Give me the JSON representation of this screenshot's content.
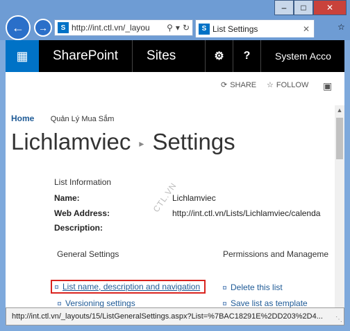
{
  "browser": {
    "window_controls": {
      "minimize": "–",
      "maximize": "□",
      "close": "✕"
    },
    "address": "http://int.ctl.vn/_layou",
    "tab_title": "List Settings",
    "status_url": "http://int.ctl.vn/_layouts/15/ListGeneralSettings.aspx?List=%7BAC18291E%2DD203%2D4..."
  },
  "suitebar": {
    "brand": "SharePoint",
    "sites": "Sites",
    "user": "System Acco"
  },
  "actions": {
    "share": "SHARE",
    "follow": "FOLLOW"
  },
  "breadcrumb": {
    "home": "Home",
    "site": "Quản Lý Mua Sắm"
  },
  "title": {
    "site": "Lichlamviec",
    "page": "Settings"
  },
  "watermark": "CTL.VN",
  "list_info": {
    "heading": "List Information",
    "name_label": "Name:",
    "name_value": "Lichlamviec",
    "web_label": "Web Address:",
    "web_value": "http://int.ctl.vn/Lists/Lichlamviec/calenda",
    "desc_label": "Description:"
  },
  "general": {
    "heading": "General Settings",
    "links": [
      "List name, description and navigation",
      "Versioning settings"
    ]
  },
  "permissions": {
    "heading": "Permissions and Manageme",
    "links": [
      "Delete this list",
      "Save list as template"
    ]
  },
  "icons": [
    "back-arrow-icon",
    "forward-arrow-icon",
    "search-icon",
    "refresh-icon",
    "sharepoint-icon",
    "waffle-icon",
    "gear-icon",
    "help-icon",
    "share-icon",
    "follow-star-icon",
    "focus-icon"
  ]
}
